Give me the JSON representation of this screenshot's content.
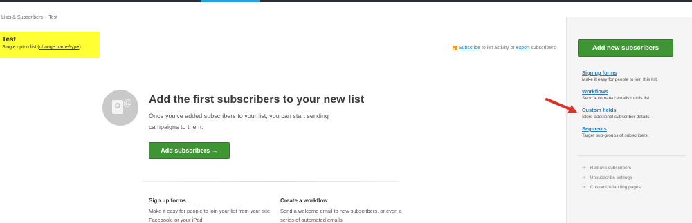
{
  "breadcrumb": {
    "parent": "Lists & Subscribers",
    "separator": "›",
    "current": "Test"
  },
  "list_header": {
    "title": "Test",
    "subtitle_prefix": "Single opt-in list (",
    "change_link": "change name/type",
    "subtitle_suffix": ")",
    "highlight_color": "#ffff33"
  },
  "subscribe_line": {
    "subscribe_link": "Subscribe",
    "middle_text": " to list activity or ",
    "export_link": "export",
    "suffix_text": " subscribers"
  },
  "empty_state": {
    "icon": "subscribers-card-icon",
    "icon_at": "@",
    "title": "Add the first subscribers to your new list",
    "description": "Once you've added subscribers to your list, you can start sending campaigns to them.",
    "button_label": "Add subscribers →"
  },
  "columns": [
    {
      "title": "Sign up forms",
      "description": "Make it easy for people to join your list from your site, Facebook, or your iPad."
    },
    {
      "title": "Create a workflow",
      "description": "Send a welcome email to new subscribers, or even a series of automated emails."
    }
  ],
  "sidebar": {
    "add_button": "Add new subscribers",
    "links": [
      {
        "label": "Sign up forms",
        "description": "Make it easy for people to join this list."
      },
      {
        "label": "Workflows",
        "description": "Send automated emails to this list."
      },
      {
        "label": "Custom fields",
        "description": "Store additional subscriber details."
      },
      {
        "label": "Segments",
        "description": "Target sub-groups of subscribers."
      }
    ],
    "actions": [
      {
        "label": "Remove subscribers"
      },
      {
        "label": "Unsubscribe settings"
      },
      {
        "label": "Customize landing pages"
      }
    ]
  },
  "colors": {
    "accent_green": "#3f9434",
    "link_blue": "#2a7ab8",
    "annotation_red": "#d9342a",
    "topbar": "#2b2e37",
    "topbar_active": "#2aa3da"
  }
}
